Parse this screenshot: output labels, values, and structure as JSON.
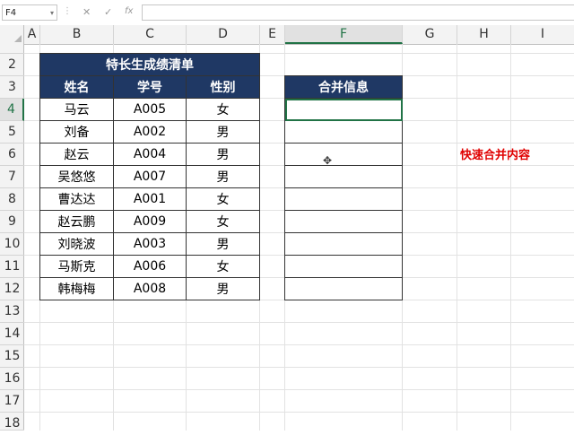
{
  "formula_bar": {
    "name_box": "F4",
    "cancel_icon": "✕",
    "enter_icon": "✓",
    "fx_label": "fx",
    "formula": ""
  },
  "columns": [
    "A",
    "B",
    "C",
    "D",
    "E",
    "F",
    "G",
    "H",
    "I"
  ],
  "selected_column": "F",
  "rows": [
    "2",
    "3",
    "4",
    "5",
    "6",
    "7",
    "8",
    "9",
    "10",
    "11",
    "12",
    "13",
    "14",
    "15",
    "16",
    "17",
    "18"
  ],
  "selected_row": "4",
  "table1": {
    "title": "特长生成绩清单",
    "headers": [
      "姓名",
      "学号",
      "性别"
    ],
    "rows": [
      [
        "马云",
        "A005",
        "女"
      ],
      [
        "刘备",
        "A002",
        "男"
      ],
      [
        "赵云",
        "A004",
        "男"
      ],
      [
        "吴悠悠",
        "A007",
        "男"
      ],
      [
        "曹达达",
        "A001",
        "女"
      ],
      [
        "赵云鹏",
        "A009",
        "女"
      ],
      [
        "刘晓波",
        "A003",
        "男"
      ],
      [
        "马斯克",
        "A006",
        "女"
      ],
      [
        "韩梅梅",
        "A008",
        "男"
      ]
    ]
  },
  "table2": {
    "header": "合并信息"
  },
  "annotation": "快速合并内容",
  "colors": {
    "header_fill": "#1f3864",
    "select_green": "#217346",
    "annotation": "#e00000"
  }
}
